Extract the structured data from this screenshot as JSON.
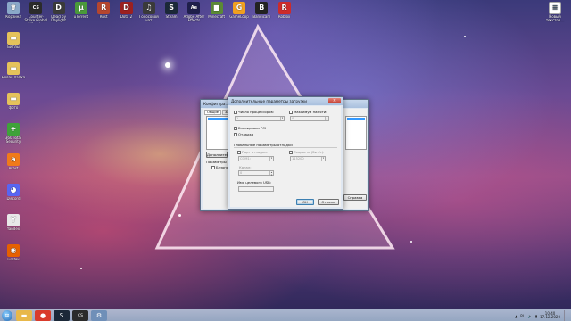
{
  "desktop": {
    "icons_top": [
      {
        "label": "Корзина",
        "icon": "recycle-bin-icon",
        "color": "#8aa8c8",
        "glyph": "🗑"
      },
      {
        "label": "Counter-Strike Global Offensive",
        "icon": "csgo-icon",
        "color": "#2b2b2b",
        "glyph": "CS"
      },
      {
        "label": "Dead by Daylight",
        "icon": "dbd-icon",
        "color": "#3a3a3a",
        "glyph": "D"
      },
      {
        "label": "uTorrent",
        "icon": "utorrent-icon",
        "color": "#4a9a3a",
        "glyph": "µ"
      },
      {
        "label": "Rust",
        "icon": "rust-icon",
        "color": "#b5462f",
        "glyph": "R"
      },
      {
        "label": "Dota 2",
        "icon": "dota-icon",
        "color": "#9b2020",
        "glyph": "D"
      },
      {
        "label": "Голосовой чат",
        "icon": "voice-chat-icon",
        "color": "#3a3a3a",
        "glyph": "♫"
      },
      {
        "label": "Steam",
        "icon": "steam-icon",
        "color": "#1b2838",
        "glyph": "S"
      },
      {
        "label": "Adobe After Effects",
        "icon": "after-effects-icon",
        "color": "#1f1f4a",
        "glyph": "Ae"
      },
      {
        "label": "Minecraft",
        "icon": "minecraft-icon",
        "color": "#5b8a35",
        "glyph": "■"
      },
      {
        "label": "GameLoop",
        "icon": "gameloop-icon",
        "color": "#f0a020",
        "glyph": "G"
      },
      {
        "label": "Bandicam",
        "icon": "bandicam-icon",
        "color": "#222222",
        "glyph": "B"
      },
      {
        "label": "Roblox",
        "icon": "roblox-icon",
        "color": "#cc2b2b",
        "glyph": "R"
      }
    ],
    "icons_left": [
      {
        "label": "Битлы",
        "icon": "folder-icon",
        "color": "#e5c25b",
        "glyph": "▬"
      },
      {
        "label": "Новая папка",
        "icon": "folder-icon",
        "color": "#e5c25b",
        "glyph": "▬"
      },
      {
        "label": "фото",
        "icon": "folder-icon",
        "color": "#e5c25b",
        "glyph": "▬"
      },
      {
        "label": "360 Total Security",
        "icon": "security-icon",
        "color": "#3fa23a",
        "glyph": "+"
      },
      {
        "label": "Avast",
        "icon": "avast-icon",
        "color": "#f07a1a",
        "glyph": "a"
      },
      {
        "label": "Discord",
        "icon": "discord-icon",
        "color": "#5865f2",
        "glyph": "◕"
      },
      {
        "label": "Yandex",
        "icon": "yandex-icon",
        "color": "#e8e8e8",
        "glyph": "Y"
      },
      {
        "label": "Firefox",
        "icon": "firefox-icon",
        "color": "#e66000",
        "glyph": "◉"
      }
    ],
    "icon_right": {
      "label": "Новый текстов...",
      "icon": "text-file-icon",
      "color": "#ffffff",
      "glyph": "≡"
    }
  },
  "back_window": {
    "title": "Конфигура...",
    "tabs": [
      "Общие",
      "Загр"
    ],
    "buttons": [
      "Дополнительн"
    ],
    "labels": [
      "Параметры",
      "Безопасн"
    ],
    "right_button": "Справка"
  },
  "dialog": {
    "title": "Дополнительные параметры загрузки",
    "processors_label": "Число процессоров:",
    "processors_value": "1",
    "max_memory_label": "Максимум памяти:",
    "max_memory_value": "0",
    "pci_lock_label": "Блокировка PCI",
    "debug_label": "Отладка",
    "global_debug_title": "Глобальные параметры отладки",
    "debug_port_label": "Порт отладки:",
    "debug_port_value": "COM1:",
    "baud_rate_label": "Скорость (бит/с):",
    "baud_rate_value": "115200",
    "channel_label": "Канал:",
    "channel_value": "0",
    "usb_target_label": "Имя целевого USB:",
    "ok_label": "ОК",
    "cancel_label": "Отмена"
  },
  "taskbar": {
    "time": "10:40",
    "date": "17.12.2020",
    "language": "RU",
    "apps": [
      {
        "name": "explorer-taskbar",
        "color": "#e8b84a",
        "glyph": "▬"
      },
      {
        "name": "chrome-taskbar",
        "color": "#d93b2b",
        "glyph": "●"
      },
      {
        "name": "steam-taskbar",
        "color": "#1b2838",
        "glyph": "S"
      },
      {
        "name": "csgo-taskbar",
        "color": "#2b2b2b",
        "glyph": "CS"
      },
      {
        "name": "msconfig-taskbar",
        "color": "#6f8fb8",
        "glyph": "⚙"
      }
    ]
  },
  "colors": {
    "accent": "#3c7fb1",
    "close": "#c0392b"
  }
}
